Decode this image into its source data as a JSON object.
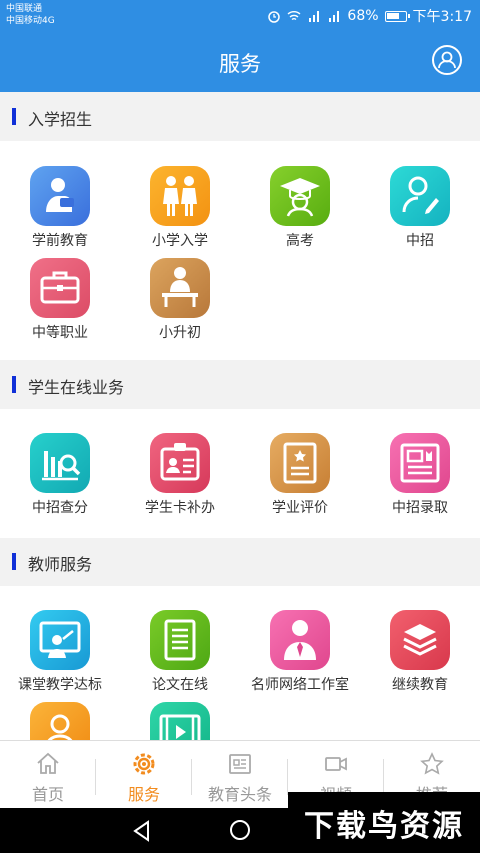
{
  "status_bar": {
    "carrier1": "中国联通",
    "carrier2": "中国移动4G",
    "battery": "68%",
    "time": "下午3:17"
  },
  "header": {
    "title": "服务"
  },
  "sections": [
    {
      "title": "入学招生",
      "items": [
        {
          "label": "学前教育",
          "icon": "preschool-icon",
          "color": "#3f7be0"
        },
        {
          "label": "小学入学",
          "icon": "children-icon",
          "color": "#f7a21a"
        },
        {
          "label": "高考",
          "icon": "graduate-icon",
          "color": "#6cbf1a"
        },
        {
          "label": "中招",
          "icon": "person-pen-icon",
          "color": "#1bc7c8"
        },
        {
          "label": "中等职业",
          "icon": "briefcase-icon",
          "color": "#e95a72"
        },
        {
          "label": "小升初",
          "icon": "student-desk-icon",
          "color": "#cc8b45"
        }
      ]
    },
    {
      "title": "学生在线业务",
      "items": [
        {
          "label": "中招查分",
          "icon": "chart-search-icon",
          "color": "#18bfc0"
        },
        {
          "label": "学生卡补办",
          "icon": "id-card-icon",
          "color": "#e44e6b"
        },
        {
          "label": "学业评价",
          "icon": "certificate-icon",
          "color": "#d5954a"
        },
        {
          "label": "中招录取",
          "icon": "newspaper-icon",
          "color": "#ec5aa0"
        }
      ]
    },
    {
      "title": "教师服务",
      "items": [
        {
          "label": "课堂教学达标",
          "icon": "classroom-board-icon",
          "color": "#1fb6e0"
        },
        {
          "label": "论文在线",
          "icon": "document-icon",
          "color": "#62b61e"
        },
        {
          "label": "名师网络工作室",
          "icon": "teacher-icon",
          "color": "#ec5aa0"
        },
        {
          "label": "继续教育",
          "icon": "books-icon",
          "color": "#e8485c"
        },
        {
          "label": "",
          "icon": "profile-icon",
          "color": "#f6a21e"
        },
        {
          "label": "",
          "icon": "film-icon",
          "color": "#1fc59a"
        }
      ]
    }
  ],
  "tabbar": [
    {
      "label": "首页",
      "icon": "home-icon",
      "active": false
    },
    {
      "label": "服务",
      "icon": "gear-icon",
      "active": true
    },
    {
      "label": "教育头条",
      "icon": "news-icon",
      "active": false
    },
    {
      "label": "视频",
      "icon": "video-camera-icon",
      "active": false
    },
    {
      "label": "推荐",
      "icon": "star-icon",
      "active": false
    }
  ],
  "watermark": "下载鸟资源",
  "colors": {
    "header": "#2f8ee3",
    "accent": "#f28c1f",
    "section_bar": "#1030d8"
  }
}
